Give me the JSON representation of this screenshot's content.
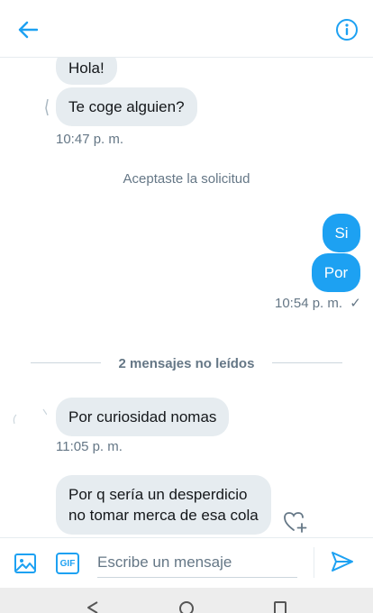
{
  "header": {
    "back_icon": "arrow-left-icon",
    "info_icon": "info-icon",
    "accent": "#1da1f2"
  },
  "messages": {
    "m1": "Hola!",
    "m2": "Te coge alguien?",
    "t1": "10:47 p. m.",
    "system": "Aceptaste la solicitud",
    "o1": "Si",
    "o2": "Por",
    "t2": "10:54 p. m.",
    "t2_check": "✓",
    "unread": "2 mensajes no leídos",
    "m3": "Por curiosidad nomas",
    "t3": "11:05 p. m.",
    "m4_line1": "Por q sería un desperdicio",
    "m4_line2": "no tomar merca de esa cola"
  },
  "composer": {
    "placeholder": "Escribe un mensaje",
    "gif_label": "GIF"
  },
  "colors": {
    "incoming_bubble": "#e6ecf0",
    "outgoing_bubble": "#1da1f2",
    "muted_text": "#657786"
  }
}
